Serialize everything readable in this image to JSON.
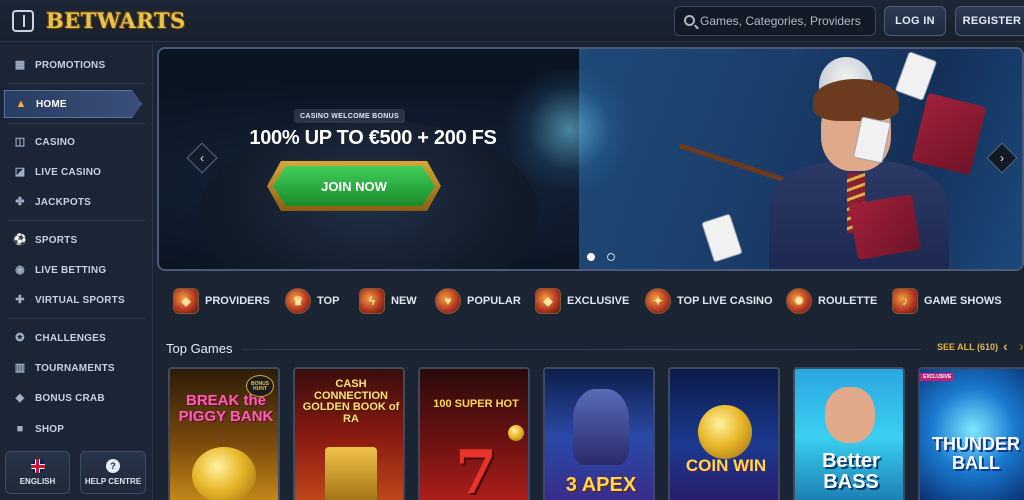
{
  "header": {
    "logo_text": "BETWARTS",
    "search_placeholder": "Games, Categories, Providers",
    "login_label": "LOG IN",
    "register_label": "REGISTER",
    "icons": [
      "menu-toggle-icon",
      "search-icon"
    ]
  },
  "sidebar": {
    "items": [
      {
        "label": "PROMOTIONS",
        "icon": "promotions-icon",
        "glyph": "▦"
      },
      {
        "label": "HOME",
        "icon": "wizard-hat-icon",
        "glyph": "▲",
        "active": true
      },
      {
        "label": "CASINO",
        "icon": "casino-icon",
        "glyph": "◫"
      },
      {
        "label": "LIVE CASINO",
        "icon": "live-casino-icon",
        "glyph": "◪"
      },
      {
        "label": "JACKPOTS",
        "icon": "jackpots-icon",
        "glyph": "✤"
      },
      {
        "label": "SPORTS",
        "icon": "sports-ball-icon",
        "glyph": "⚽"
      },
      {
        "label": "LIVE BETTING",
        "icon": "live-betting-icon",
        "glyph": "◉"
      },
      {
        "label": "VIRTUAL SPORTS",
        "icon": "gamepad-icon",
        "glyph": "✚"
      },
      {
        "label": "CHALLENGES",
        "icon": "challenges-icon",
        "glyph": "✪"
      },
      {
        "label": "TOURNAMENTS",
        "icon": "tournaments-icon",
        "glyph": "▥"
      },
      {
        "label": "BONUS CRAB",
        "icon": "bonus-crab-icon",
        "glyph": "◆"
      },
      {
        "label": "SHOP",
        "icon": "shop-bag-icon",
        "glyph": "■"
      }
    ],
    "language_label": "ENGLISH",
    "help_label": "HELP CENTRE",
    "help_glyph": "?"
  },
  "hero": {
    "tag": "CASINO WELCOME BONUS",
    "title": "100% UP TO €500 + 200 FS",
    "cta_label": "JOIN NOW",
    "prev_glyph": "‹",
    "next_glyph": "›",
    "slides_total": 2,
    "active_slide": 1
  },
  "categories": [
    {
      "label": "PROVIDERS",
      "icon": "providers-icon",
      "glyph": "◈"
    },
    {
      "label": "TOP",
      "icon": "top-crown-icon",
      "glyph": "♛"
    },
    {
      "label": "NEW",
      "icon": "new-lightning-icon",
      "glyph": "ϟ"
    },
    {
      "label": "POPULAR",
      "icon": "popular-icon",
      "glyph": "♥"
    },
    {
      "label": "EXCLUSIVE",
      "icon": "exclusive-icon",
      "glyph": "◆"
    },
    {
      "label": "TOP LIVE CASINO",
      "icon": "top-live-casino-icon",
      "glyph": "✦"
    },
    {
      "label": "ROULETTE",
      "icon": "roulette-icon",
      "glyph": "✹"
    },
    {
      "label": "GAME SHOWS",
      "icon": "game-shows-icon",
      "glyph": "♪"
    }
  ],
  "top_games": {
    "title": "Top Games",
    "see_all_label": "SEE ALL (610)",
    "prev_glyph": "‹",
    "next_glyph": "›",
    "games": [
      {
        "title": "BREAK the PIGGY BANK",
        "badge": "BONUS HUNT"
      },
      {
        "title": "CASH CONNECTION GOLDEN BOOK of RA"
      },
      {
        "title": "100 SUPER HOT"
      },
      {
        "title": "3 APEX"
      },
      {
        "title": "COIN WIN"
      },
      {
        "title": "Better BASS"
      },
      {
        "title": "THUNDER BALL",
        "badge": "EXCLUSIVE"
      }
    ]
  },
  "colors": {
    "background": "#1b2432",
    "accent_gold": "#e0b24a",
    "cta_green": "#2fb547",
    "active_nav": "#3a4f7a"
  }
}
